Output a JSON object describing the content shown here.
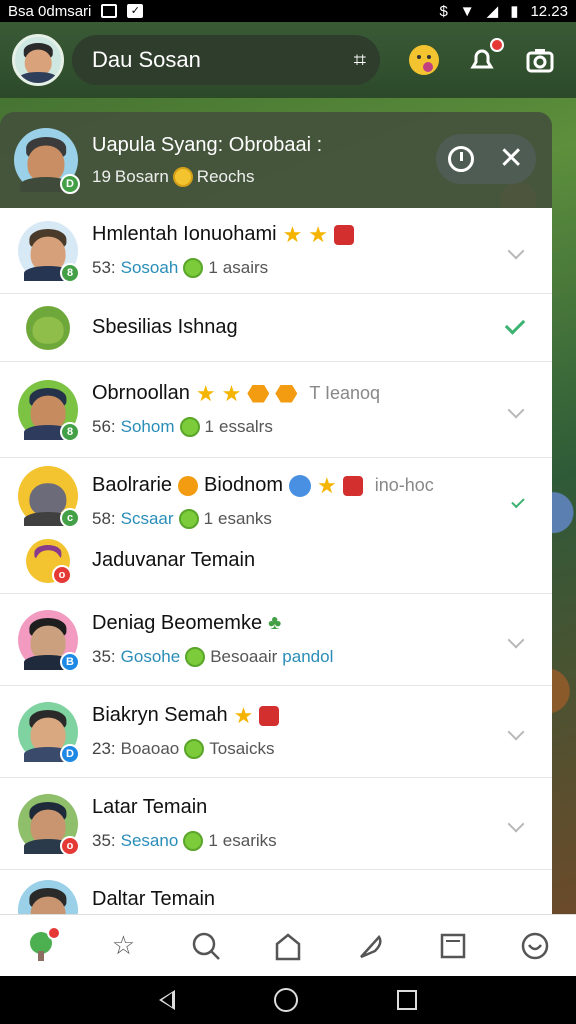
{
  "status_bar": {
    "left_text": "Bsa 0dmsari",
    "time": "12.23"
  },
  "header": {
    "title": "Dau Sosan"
  },
  "active_notification": {
    "title": "Uapula Syang: Obrobaai :",
    "subtitle_prefix": "19",
    "subtitle_a": "Bosarn",
    "subtitle_b": "Reochs"
  },
  "friends": [
    {
      "name": "Hmlentah Ionuohami",
      "sub_prefix": "53:",
      "sub_a": "Sosoah",
      "sub_count": "1",
      "sub_b": "asairs",
      "badge": "8",
      "badge_color": "#43a047",
      "status": "collapsed"
    },
    {
      "name": "Sbesilias Ishnag",
      "status": "checked"
    },
    {
      "name": "Obrnoollan",
      "sub_prefix": "56:",
      "sub_a": "Sohom",
      "sub_count": "1",
      "sub_b": "essalrs",
      "tail": "T Ieanoq",
      "badge": "8",
      "badge_color": "#43a047",
      "status": "collapsed"
    },
    {
      "name": "Baolrarie",
      "name_extra": "Biodnom",
      "sub_prefix": "58:",
      "sub_a": "Scsaar",
      "sub_count": "1",
      "sub_b": "esanks",
      "tail": "ino-hoc",
      "badge": "c",
      "badge_color": "#43a047",
      "status": "checked"
    },
    {
      "name": "Jaduvanar Temain",
      "badge": "o",
      "badge_color": "#e53935",
      "status": "none"
    },
    {
      "name": "Deniag Beomemke",
      "sub_prefix": "35:",
      "sub_a": "Gosohe",
      "sub_b": "Besoaair",
      "sub_c": "pandol",
      "badge": "B",
      "badge_color": "#1e88e5",
      "status": "collapsed"
    },
    {
      "name": "Biakryn Semah",
      "sub_prefix": "23:",
      "sub_a": "Boaoao",
      "sub_b": "Tosaicks",
      "badge": "D",
      "badge_color": "#1e88e5",
      "status": "collapsed"
    },
    {
      "name": "Latar Temain",
      "sub_prefix": "35:",
      "sub_a": "Sesano",
      "sub_count": "1",
      "sub_b": "esariks",
      "badge": "o",
      "badge_color": "#e53935",
      "status": "collapsed"
    },
    {
      "name": "Daltar Temain"
    }
  ]
}
